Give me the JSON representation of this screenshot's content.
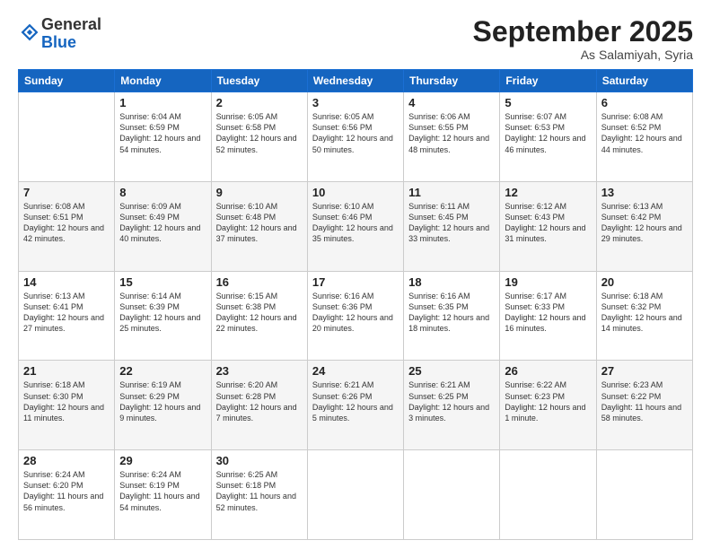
{
  "header": {
    "logo_general": "General",
    "logo_blue": "Blue",
    "month_title": "September 2025",
    "location": "As Salamiyah, Syria"
  },
  "days_of_week": [
    "Sunday",
    "Monday",
    "Tuesday",
    "Wednesday",
    "Thursday",
    "Friday",
    "Saturday"
  ],
  "weeks": [
    [
      {
        "day": "",
        "sunrise": "",
        "sunset": "",
        "daylight": ""
      },
      {
        "day": "1",
        "sunrise": "Sunrise: 6:04 AM",
        "sunset": "Sunset: 6:59 PM",
        "daylight": "Daylight: 12 hours and 54 minutes."
      },
      {
        "day": "2",
        "sunrise": "Sunrise: 6:05 AM",
        "sunset": "Sunset: 6:58 PM",
        "daylight": "Daylight: 12 hours and 52 minutes."
      },
      {
        "day": "3",
        "sunrise": "Sunrise: 6:05 AM",
        "sunset": "Sunset: 6:56 PM",
        "daylight": "Daylight: 12 hours and 50 minutes."
      },
      {
        "day": "4",
        "sunrise": "Sunrise: 6:06 AM",
        "sunset": "Sunset: 6:55 PM",
        "daylight": "Daylight: 12 hours and 48 minutes."
      },
      {
        "day": "5",
        "sunrise": "Sunrise: 6:07 AM",
        "sunset": "Sunset: 6:53 PM",
        "daylight": "Daylight: 12 hours and 46 minutes."
      },
      {
        "day": "6",
        "sunrise": "Sunrise: 6:08 AM",
        "sunset": "Sunset: 6:52 PM",
        "daylight": "Daylight: 12 hours and 44 minutes."
      }
    ],
    [
      {
        "day": "7",
        "sunrise": "Sunrise: 6:08 AM",
        "sunset": "Sunset: 6:51 PM",
        "daylight": "Daylight: 12 hours and 42 minutes."
      },
      {
        "day": "8",
        "sunrise": "Sunrise: 6:09 AM",
        "sunset": "Sunset: 6:49 PM",
        "daylight": "Daylight: 12 hours and 40 minutes."
      },
      {
        "day": "9",
        "sunrise": "Sunrise: 6:10 AM",
        "sunset": "Sunset: 6:48 PM",
        "daylight": "Daylight: 12 hours and 37 minutes."
      },
      {
        "day": "10",
        "sunrise": "Sunrise: 6:10 AM",
        "sunset": "Sunset: 6:46 PM",
        "daylight": "Daylight: 12 hours and 35 minutes."
      },
      {
        "day": "11",
        "sunrise": "Sunrise: 6:11 AM",
        "sunset": "Sunset: 6:45 PM",
        "daylight": "Daylight: 12 hours and 33 minutes."
      },
      {
        "day": "12",
        "sunrise": "Sunrise: 6:12 AM",
        "sunset": "Sunset: 6:43 PM",
        "daylight": "Daylight: 12 hours and 31 minutes."
      },
      {
        "day": "13",
        "sunrise": "Sunrise: 6:13 AM",
        "sunset": "Sunset: 6:42 PM",
        "daylight": "Daylight: 12 hours and 29 minutes."
      }
    ],
    [
      {
        "day": "14",
        "sunrise": "Sunrise: 6:13 AM",
        "sunset": "Sunset: 6:41 PM",
        "daylight": "Daylight: 12 hours and 27 minutes."
      },
      {
        "day": "15",
        "sunrise": "Sunrise: 6:14 AM",
        "sunset": "Sunset: 6:39 PM",
        "daylight": "Daylight: 12 hours and 25 minutes."
      },
      {
        "day": "16",
        "sunrise": "Sunrise: 6:15 AM",
        "sunset": "Sunset: 6:38 PM",
        "daylight": "Daylight: 12 hours and 22 minutes."
      },
      {
        "day": "17",
        "sunrise": "Sunrise: 6:16 AM",
        "sunset": "Sunset: 6:36 PM",
        "daylight": "Daylight: 12 hours and 20 minutes."
      },
      {
        "day": "18",
        "sunrise": "Sunrise: 6:16 AM",
        "sunset": "Sunset: 6:35 PM",
        "daylight": "Daylight: 12 hours and 18 minutes."
      },
      {
        "day": "19",
        "sunrise": "Sunrise: 6:17 AM",
        "sunset": "Sunset: 6:33 PM",
        "daylight": "Daylight: 12 hours and 16 minutes."
      },
      {
        "day": "20",
        "sunrise": "Sunrise: 6:18 AM",
        "sunset": "Sunset: 6:32 PM",
        "daylight": "Daylight: 12 hours and 14 minutes."
      }
    ],
    [
      {
        "day": "21",
        "sunrise": "Sunrise: 6:18 AM",
        "sunset": "Sunset: 6:30 PM",
        "daylight": "Daylight: 12 hours and 11 minutes."
      },
      {
        "day": "22",
        "sunrise": "Sunrise: 6:19 AM",
        "sunset": "Sunset: 6:29 PM",
        "daylight": "Daylight: 12 hours and 9 minutes."
      },
      {
        "day": "23",
        "sunrise": "Sunrise: 6:20 AM",
        "sunset": "Sunset: 6:28 PM",
        "daylight": "Daylight: 12 hours and 7 minutes."
      },
      {
        "day": "24",
        "sunrise": "Sunrise: 6:21 AM",
        "sunset": "Sunset: 6:26 PM",
        "daylight": "Daylight: 12 hours and 5 minutes."
      },
      {
        "day": "25",
        "sunrise": "Sunrise: 6:21 AM",
        "sunset": "Sunset: 6:25 PM",
        "daylight": "Daylight: 12 hours and 3 minutes."
      },
      {
        "day": "26",
        "sunrise": "Sunrise: 6:22 AM",
        "sunset": "Sunset: 6:23 PM",
        "daylight": "Daylight: 12 hours and 1 minute."
      },
      {
        "day": "27",
        "sunrise": "Sunrise: 6:23 AM",
        "sunset": "Sunset: 6:22 PM",
        "daylight": "Daylight: 11 hours and 58 minutes."
      }
    ],
    [
      {
        "day": "28",
        "sunrise": "Sunrise: 6:24 AM",
        "sunset": "Sunset: 6:20 PM",
        "daylight": "Daylight: 11 hours and 56 minutes."
      },
      {
        "day": "29",
        "sunrise": "Sunrise: 6:24 AM",
        "sunset": "Sunset: 6:19 PM",
        "daylight": "Daylight: 11 hours and 54 minutes."
      },
      {
        "day": "30",
        "sunrise": "Sunrise: 6:25 AM",
        "sunset": "Sunset: 6:18 PM",
        "daylight": "Daylight: 11 hours and 52 minutes."
      },
      {
        "day": "",
        "sunrise": "",
        "sunset": "",
        "daylight": ""
      },
      {
        "day": "",
        "sunrise": "",
        "sunset": "",
        "daylight": ""
      },
      {
        "day": "",
        "sunrise": "",
        "sunset": "",
        "daylight": ""
      },
      {
        "day": "",
        "sunrise": "",
        "sunset": "",
        "daylight": ""
      }
    ]
  ]
}
